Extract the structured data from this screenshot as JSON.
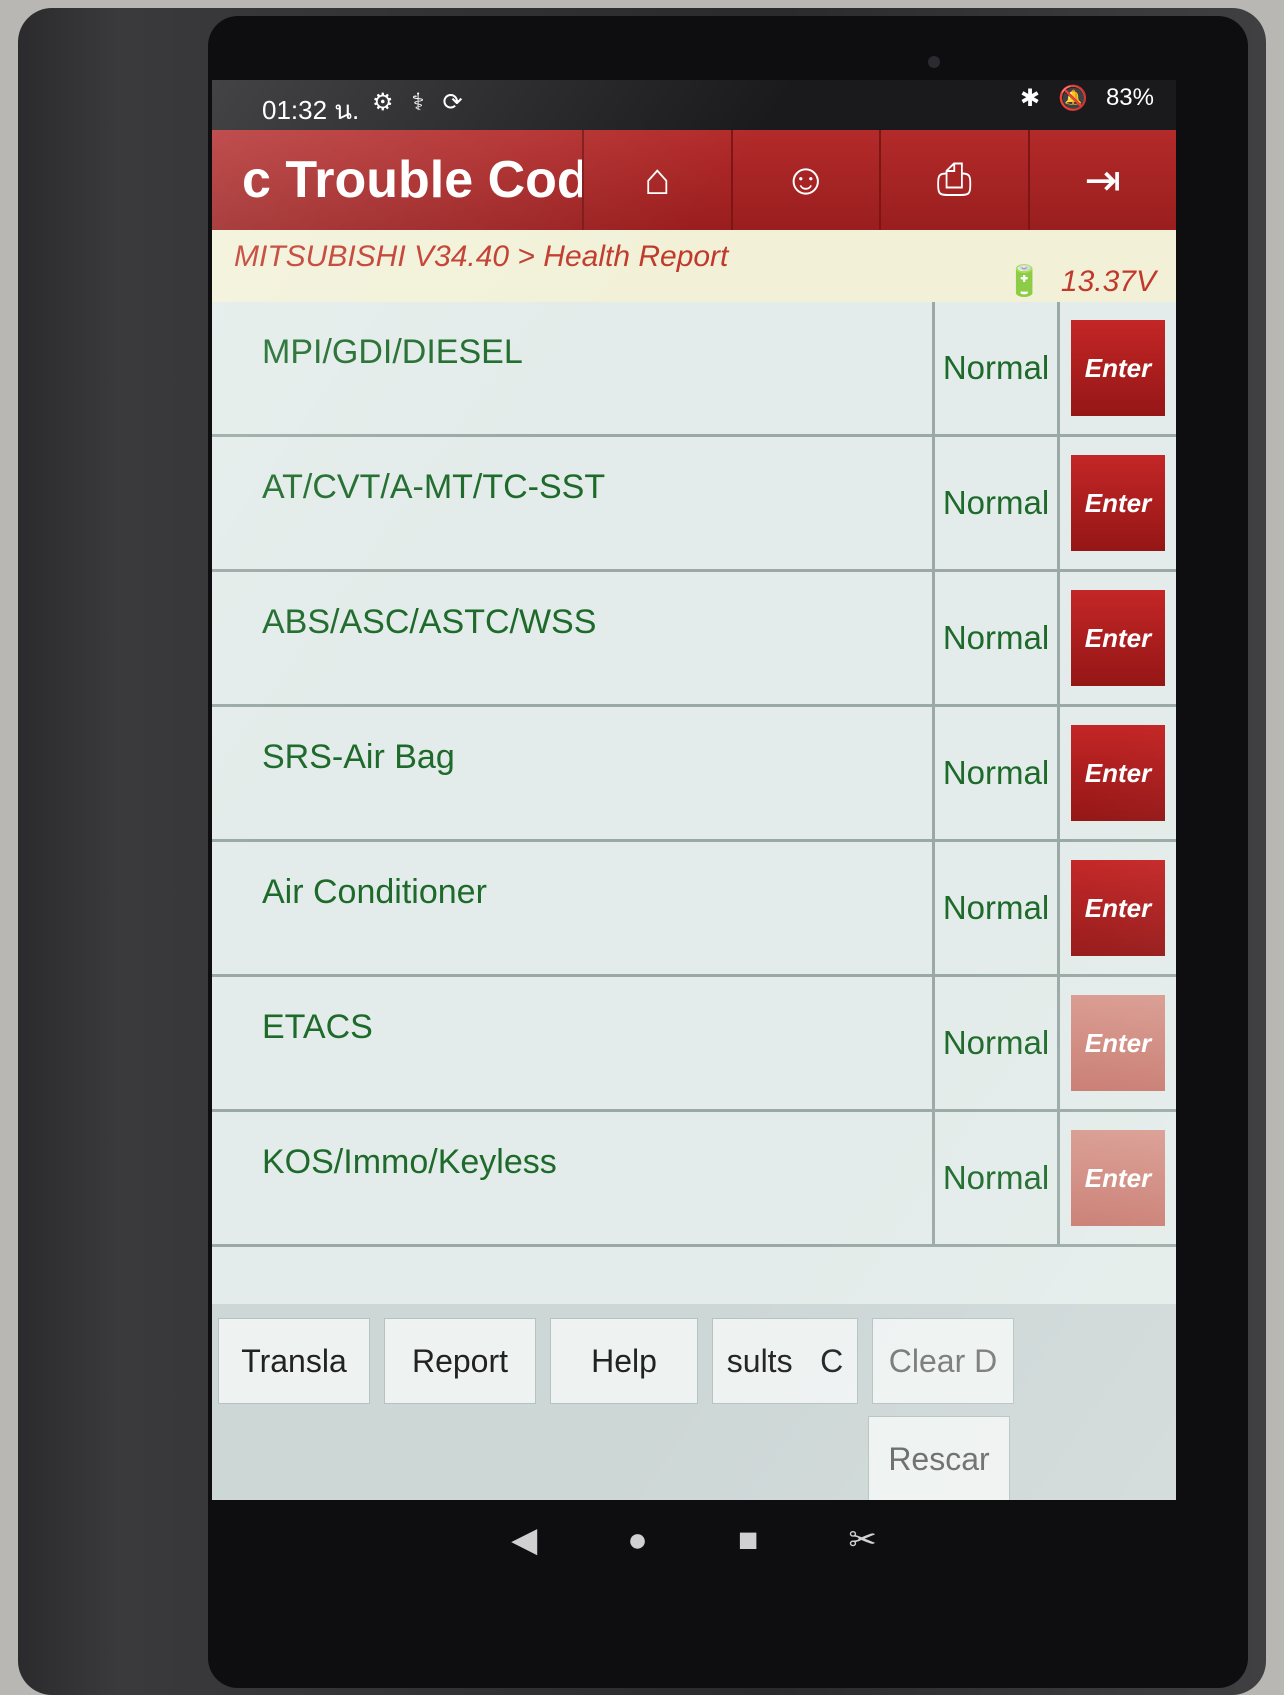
{
  "statusbar": {
    "time": "01:32 น.",
    "icons": [
      "gear-icon",
      "stethoscope-icon",
      "sync-icon"
    ],
    "right_icons": [
      "bluetooth-icon",
      "mute-icon"
    ],
    "battery": "83%"
  },
  "titlebar": {
    "title": "c Trouble Code",
    "buttons": [
      "home-icon",
      "support-icon",
      "print-icon",
      "exit-icon"
    ]
  },
  "breadcrumb": {
    "path": "MITSUBISHI V34.40 > Health Report",
    "voltage": "13.37V"
  },
  "systems": [
    {
      "name": "MPI/GDI/DIESEL",
      "status": "Normal",
      "action": "Enter"
    },
    {
      "name": "AT/CVT/A-MT/TC-SST",
      "status": "Normal",
      "action": "Enter"
    },
    {
      "name": "ABS/ASC/ASTC/WSS",
      "status": "Normal",
      "action": "Enter"
    },
    {
      "name": "SRS-Air Bag",
      "status": "Normal",
      "action": "Enter"
    },
    {
      "name": "Air Conditioner",
      "status": "Normal",
      "action": "Enter"
    },
    {
      "name": "ETACS",
      "status": "Normal",
      "action": "Enter"
    },
    {
      "name": "KOS/Immo/Keyless",
      "status": "Normal",
      "action": "Enter"
    }
  ],
  "toolbar": {
    "translate": "Transla",
    "report": "Report",
    "help": "Help",
    "results": "sults",
    "c": "C",
    "clear": "Clear D",
    "rescan": "Rescar"
  },
  "colors": {
    "title_red": "#a82222",
    "status_green": "#1d6a2a",
    "breadcrumb_red": "#c0392b"
  }
}
